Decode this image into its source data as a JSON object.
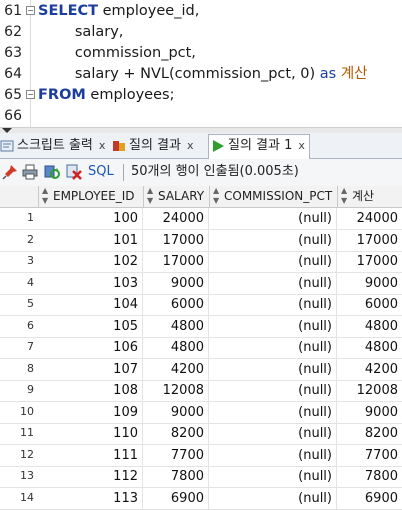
{
  "editor": {
    "lines": [
      {
        "num": "61",
        "parts": [
          {
            "t": "SELECT",
            "c": "kw"
          },
          {
            "t": " employee_id,",
            "c": "fn"
          }
        ]
      },
      {
        "num": "62",
        "parts": [
          {
            "t": "        salary,",
            "c": "fn"
          }
        ]
      },
      {
        "num": "63",
        "parts": [
          {
            "t": "        commission_pct,",
            "c": "fn"
          }
        ]
      },
      {
        "num": "64",
        "parts": [
          {
            "t": "        salary + NVL(commission_pct, 0) ",
            "c": "fn"
          },
          {
            "t": "as",
            "c": "kw2"
          },
          {
            "t": " 계산",
            "c": "orange"
          }
        ]
      },
      {
        "num": "65",
        "parts": [
          {
            "t": "FROM",
            "c": "kw"
          },
          {
            "t": " employees;",
            "c": "fn"
          }
        ]
      },
      {
        "num": "66",
        "parts": []
      }
    ]
  },
  "tabs": [
    {
      "label": "스크립트 출력",
      "close": "x",
      "icon": "script-output-icon",
      "active": false
    },
    {
      "label": "질의 결과",
      "close": "x",
      "icon": "query-result-icon",
      "active": false
    },
    {
      "label": "질의 결과 1",
      "close": "x",
      "icon": "run-icon",
      "active": true
    }
  ],
  "toolbar": {
    "icons": [
      "pin-icon",
      "print-icon",
      "refresh-icon",
      "export-icon"
    ],
    "sql_label": "SQL",
    "status": "50개의 행이 인출됨(0.005초)"
  },
  "grid": {
    "columns": [
      "EMPLOYEE_ID",
      "SALARY",
      "COMMISSION_PCT",
      "계산"
    ],
    "rows": [
      [
        "1",
        "100",
        "24000",
        "(null)",
        "24000"
      ],
      [
        "2",
        "101",
        "17000",
        "(null)",
        "17000"
      ],
      [
        "3",
        "102",
        "17000",
        "(null)",
        "17000"
      ],
      [
        "4",
        "103",
        "9000",
        "(null)",
        "9000"
      ],
      [
        "5",
        "104",
        "6000",
        "(null)",
        "6000"
      ],
      [
        "6",
        "105",
        "4800",
        "(null)",
        "4800"
      ],
      [
        "7",
        "106",
        "4800",
        "(null)",
        "4800"
      ],
      [
        "8",
        "107",
        "4200",
        "(null)",
        "4200"
      ],
      [
        "9",
        "108",
        "12008",
        "(null)",
        "12008"
      ],
      [
        "10",
        "109",
        "9000",
        "(null)",
        "9000"
      ],
      [
        "11",
        "110",
        "8200",
        "(null)",
        "8200"
      ],
      [
        "12",
        "111",
        "7700",
        "(null)",
        "7700"
      ],
      [
        "13",
        "112",
        "7800",
        "(null)",
        "7800"
      ],
      [
        "14",
        "113",
        "6900",
        "(null)",
        "6900"
      ]
    ]
  }
}
